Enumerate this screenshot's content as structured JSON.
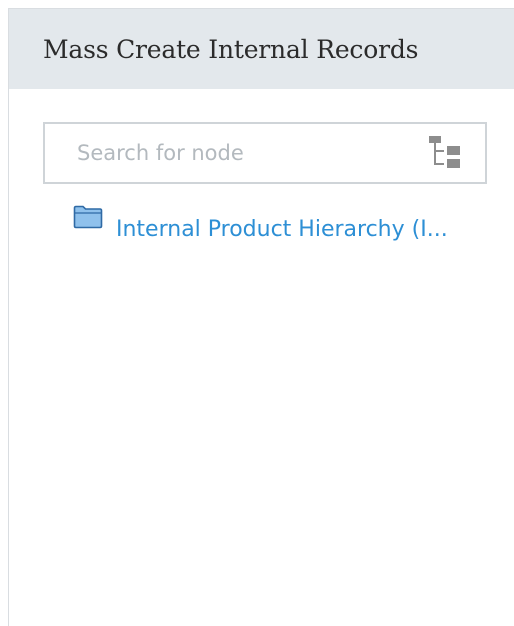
{
  "panel": {
    "title": "Mass Create Internal Records"
  },
  "search": {
    "placeholder": "Search for node",
    "value": ""
  },
  "tree": {
    "nodes": [
      {
        "label": "Internal Product Hierarchy (I...",
        "icon": "folder-icon"
      }
    ]
  },
  "colors": {
    "header_bg": "#e3e8ec",
    "link": "#2d8fd5",
    "folder": "#8fc1ec"
  }
}
